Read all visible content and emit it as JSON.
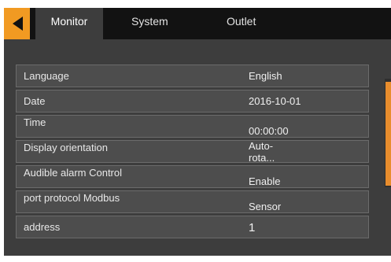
{
  "tabs": [
    {
      "label": "Monitor"
    },
    {
      "label": "System"
    },
    {
      "label": "Outlet"
    }
  ],
  "settings": [
    {
      "label": "Language",
      "value": "English"
    },
    {
      "label": "Date",
      "value": "2016-10-01"
    },
    {
      "label": "Time",
      "value": "00:00:00"
    },
    {
      "label": "Display orientation",
      "value_line1": "Auto-",
      "value_line2": "rota..."
    },
    {
      "label": "Audible alarm Control",
      "value": "Enable"
    },
    {
      "label": "port protocol Modbus",
      "value": "Sensor"
    },
    {
      "label": "address",
      "value": "1"
    }
  ],
  "colors": {
    "accent": "#f19a22",
    "topbar": "#121212",
    "screen_bg": "#3d3d3d",
    "row_bg": "#4d4d4d",
    "row_border": "#6b6b6b"
  },
  "icons": {
    "back": "triangle-left-icon"
  }
}
